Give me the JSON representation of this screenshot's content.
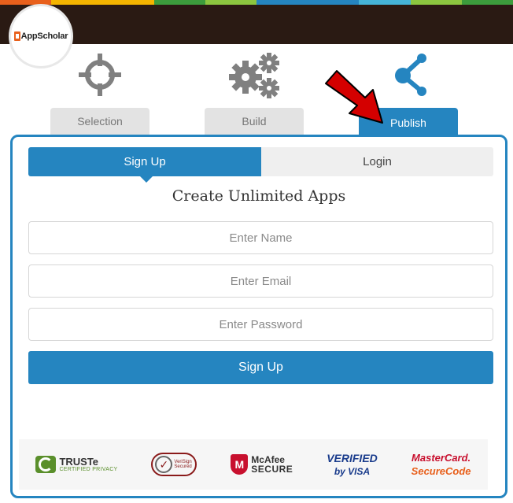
{
  "header": {
    "logo_text": "AppScholar",
    "strip_colors": [
      "#e8601c",
      "#f4b400",
      "#f4b400",
      "#3c9c3c",
      "#8cc63f",
      "#2585c0",
      "#2585c0",
      "#45b4d8",
      "#8cc63f",
      "#3c9c3c"
    ],
    "band_color": "#2a1a13"
  },
  "steps": [
    {
      "label": "Selection",
      "icon": "crosshair-icon",
      "active": false
    },
    {
      "label": "Build",
      "icon": "gears-icon",
      "active": false
    },
    {
      "label": "Publish",
      "icon": "share-icon",
      "active": true
    }
  ],
  "auth": {
    "signup_tab": "Sign Up",
    "login_tab": "Login",
    "title": "Create Unlimited Apps",
    "name_placeholder": "Enter Name",
    "email_placeholder": "Enter Email",
    "password_placeholder": "Enter Password",
    "submit_label": "Sign Up"
  },
  "badges": {
    "truste_main": "TRUSTe",
    "truste_sub": "CERTIFIED PRIVACY",
    "verisign_line1": "VeriSign",
    "verisign_line2": "Secured",
    "mcafee_main": "McAfee",
    "mcafee_sub": "SECURE",
    "visa_main": "VERIFIED",
    "visa_sub": "by VISA",
    "mc_main": "MasterCard.",
    "mc_sub": "SecureCode"
  },
  "colors": {
    "accent": "#2585c0",
    "tab_inactive": "#e3e3e3",
    "arrow_red": "#d40000"
  }
}
